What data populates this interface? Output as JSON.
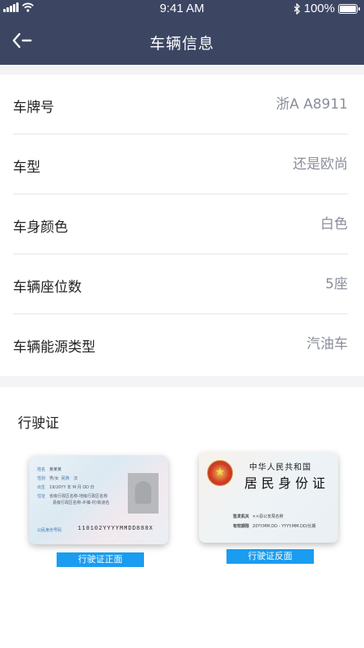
{
  "status_bar": {
    "time": "9:41 AM",
    "battery": "100%",
    "battery_level": 1.0
  },
  "header": {
    "title": "车辆信息",
    "back_icon": "back-arrow-icon"
  },
  "vehicle": [
    {
      "label": "车牌号",
      "value": "浙A   A8911"
    },
    {
      "label": "车型",
      "value": "还是欧尚"
    },
    {
      "label": "车身颜色",
      "value": "白色"
    },
    {
      "label": "车辆座位数",
      "value": "5座"
    },
    {
      "label": "车辆能源类型",
      "value": "汽油车"
    }
  ],
  "license": {
    "heading": "行驶证",
    "front": {
      "name_key": "姓名",
      "name": "某某某",
      "gender_key": "性别",
      "gender": "男/女",
      "ethnicity_key": "民族",
      "ethnicity": "汉",
      "birth_key": "出生",
      "birth": "19/20YY 年 M 月 DD 日",
      "address_key": "住址",
      "address1": "省级行政区名称-地级行政区名称",
      "address2": "县级行政区名称-乡镇-村/街道名",
      "id_label": "公民身份号码",
      "id_number": "110102YYYYMMDD888X",
      "button": "行驶证正面"
    },
    "back": {
      "title_small": "中华人民共和国",
      "title_big": "居民身份证",
      "issuer_key": "签发机关",
      "issuer": "××县公安局名称",
      "validity_key": "有效期限",
      "validity": "20YY.MM.DD - YYYY.MM.DD/长期",
      "button": "行驶证反面"
    }
  },
  "colors": {
    "header_bg": "#3c4663",
    "accent": "#1a9cf0"
  }
}
